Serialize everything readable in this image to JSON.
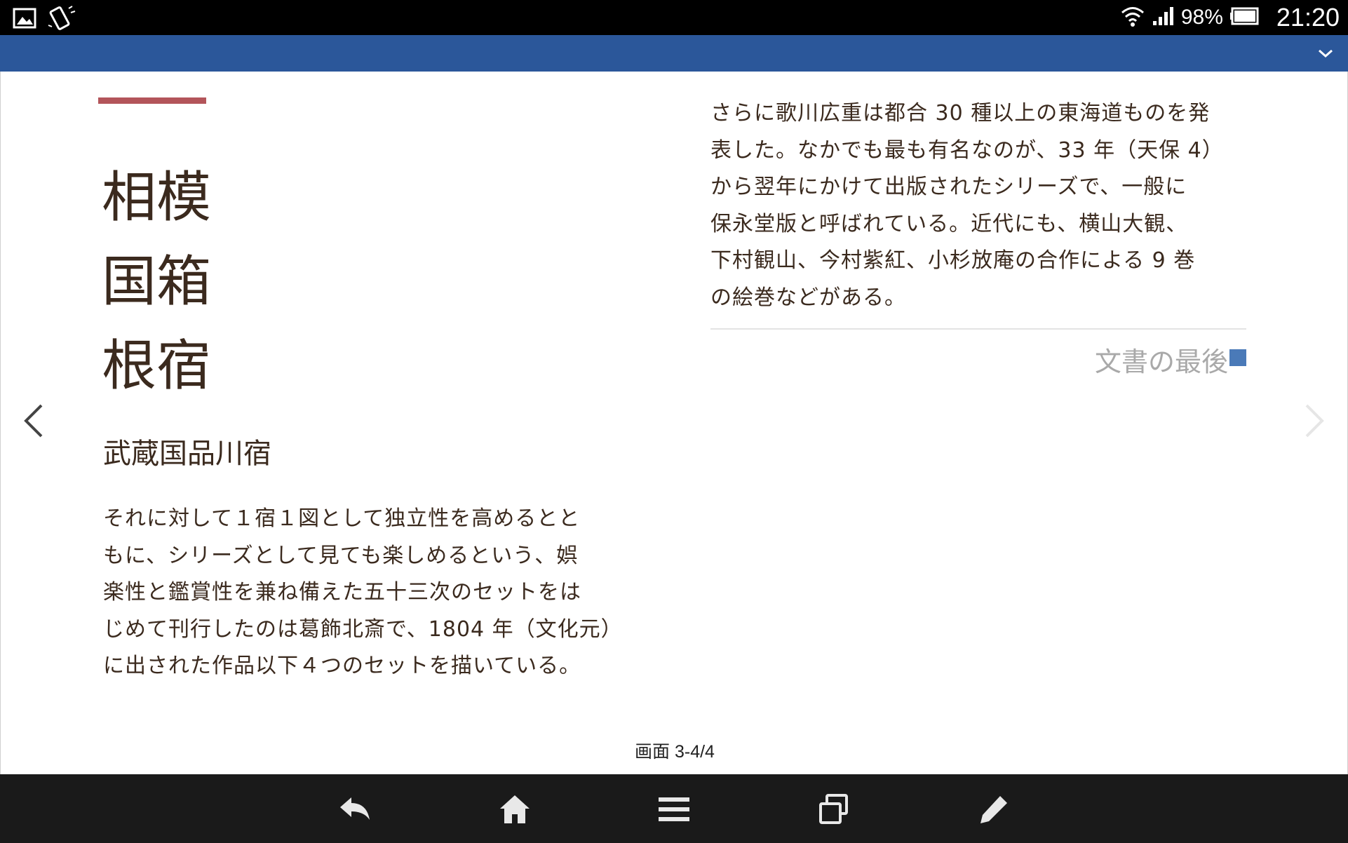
{
  "status_bar": {
    "battery_percent": "98%",
    "time": "21:20",
    "icons": [
      "image-icon",
      "screen-rotate-icon",
      "wifi-icon",
      "signal-icon",
      "battery-icon"
    ]
  },
  "header": {
    "color": "#2b579a",
    "collapse_icon": "chevron-down-icon"
  },
  "document": {
    "accent_color": "#b3555a",
    "title_lines": [
      "相模",
      "国箱",
      "根宿"
    ],
    "subtitle": "武蔵国品川宿",
    "left_paragraph_lines": [
      "それに対して１宿１図として独立性を高めるとと",
      "もに、シリーズとして見ても楽しめるという、娯",
      "楽性と鑑賞性を兼ね備えた五十三次のセットをは",
      "じめて刊行したのは葛飾北斎で、1804 年（文化元）",
      "に出された作品以下４つのセットを描いている。"
    ],
    "right_paragraph_lines": [
      "さらに歌川広重は都合 30 種以上の東海道ものを発",
      "表した。なかでも最も有名なのが、33 年（天保 4）",
      "から翌年にかけて出版されたシリーズで、一般に",
      "保永堂版と呼ばれている。近代にも、横山大観、",
      "下村観山、今村紫紅、小杉放庵の合作による 9 巻",
      "の絵巻などがある。"
    ],
    "end_label": "文書の最後"
  },
  "pager": {
    "indicator": "画面 3-4/4"
  },
  "navbar": {
    "buttons": [
      "back-icon",
      "home-icon",
      "menu-icon",
      "recent-apps-icon",
      "edit-icon"
    ]
  }
}
